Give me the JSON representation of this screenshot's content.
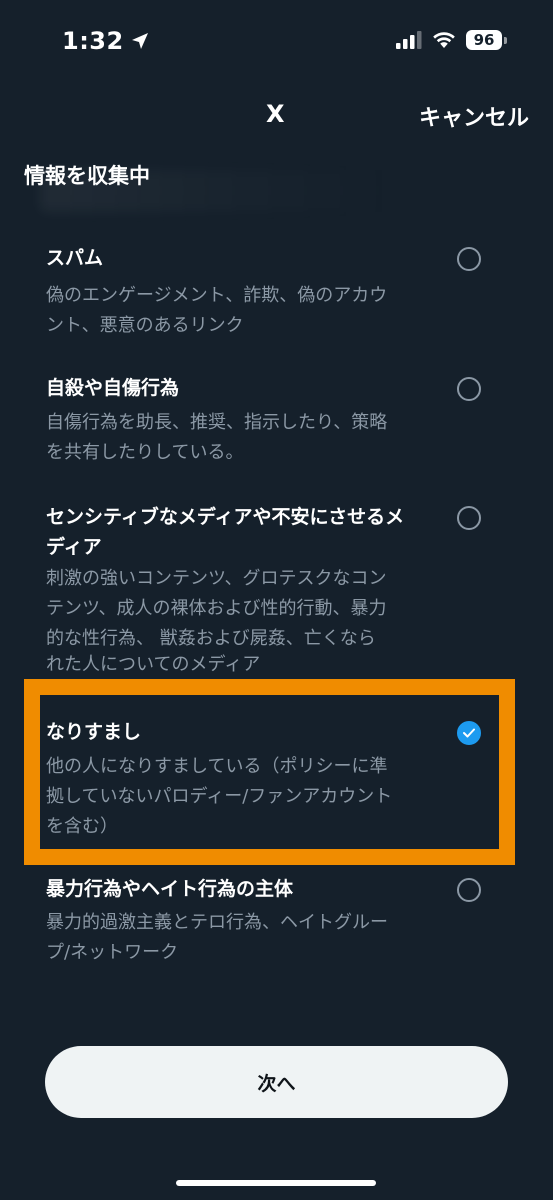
{
  "status_bar": {
    "time": "1:32",
    "battery": "96"
  },
  "header": {
    "close_label": "X",
    "cancel_label": "キャンセル"
  },
  "section_title": "情報を収集中",
  "options": [
    {
      "title_lines": [
        "スパム"
      ],
      "desc_lines": [
        "偽のエンゲージメント、詐欺、偽のアカウ",
        "ント、悪意のあるリンク"
      ],
      "selected": false
    },
    {
      "title_lines": [
        "自殺や自傷行為"
      ],
      "desc_lines": [
        "自傷行為を助長、推奨、指示したり、策略",
        "を共有したりしている。"
      ],
      "selected": false
    },
    {
      "title_lines": [
        "センシティブなメディアや不安にさせるメ",
        "ディア"
      ],
      "desc_lines": [
        "刺激の強いコンテンツ、グロテスクなコン",
        "テンツ、成人の裸体および性的行動、暴力",
        "的な性行為、 獣姦および屍姦、亡くなら",
        "れた人についてのメディア"
      ],
      "selected": false
    },
    {
      "title_lines": [
        "なりすまし"
      ],
      "desc_lines": [
        "他の人になりすましている（ポリシーに準",
        "拠していないパロディー/ファンアカウント",
        "を含む）"
      ],
      "selected": true
    },
    {
      "title_lines": [
        "暴力行為やヘイト行為の主体"
      ],
      "desc_lines": [
        "暴力的過激主義とテロ行為、ヘイトグルー",
        "プ/ネットワーク"
      ],
      "selected": false
    }
  ],
  "next_button_label": "次へ",
  "colors": {
    "background": "#15202b",
    "highlight": "#f08c00",
    "accent": "#1d9bf0",
    "secondary_text": "#8b98a5"
  },
  "icons": {
    "location": "location-arrow-icon",
    "signal": "cellular-signal-icon",
    "wifi": "wifi-icon",
    "check": "check-icon"
  }
}
